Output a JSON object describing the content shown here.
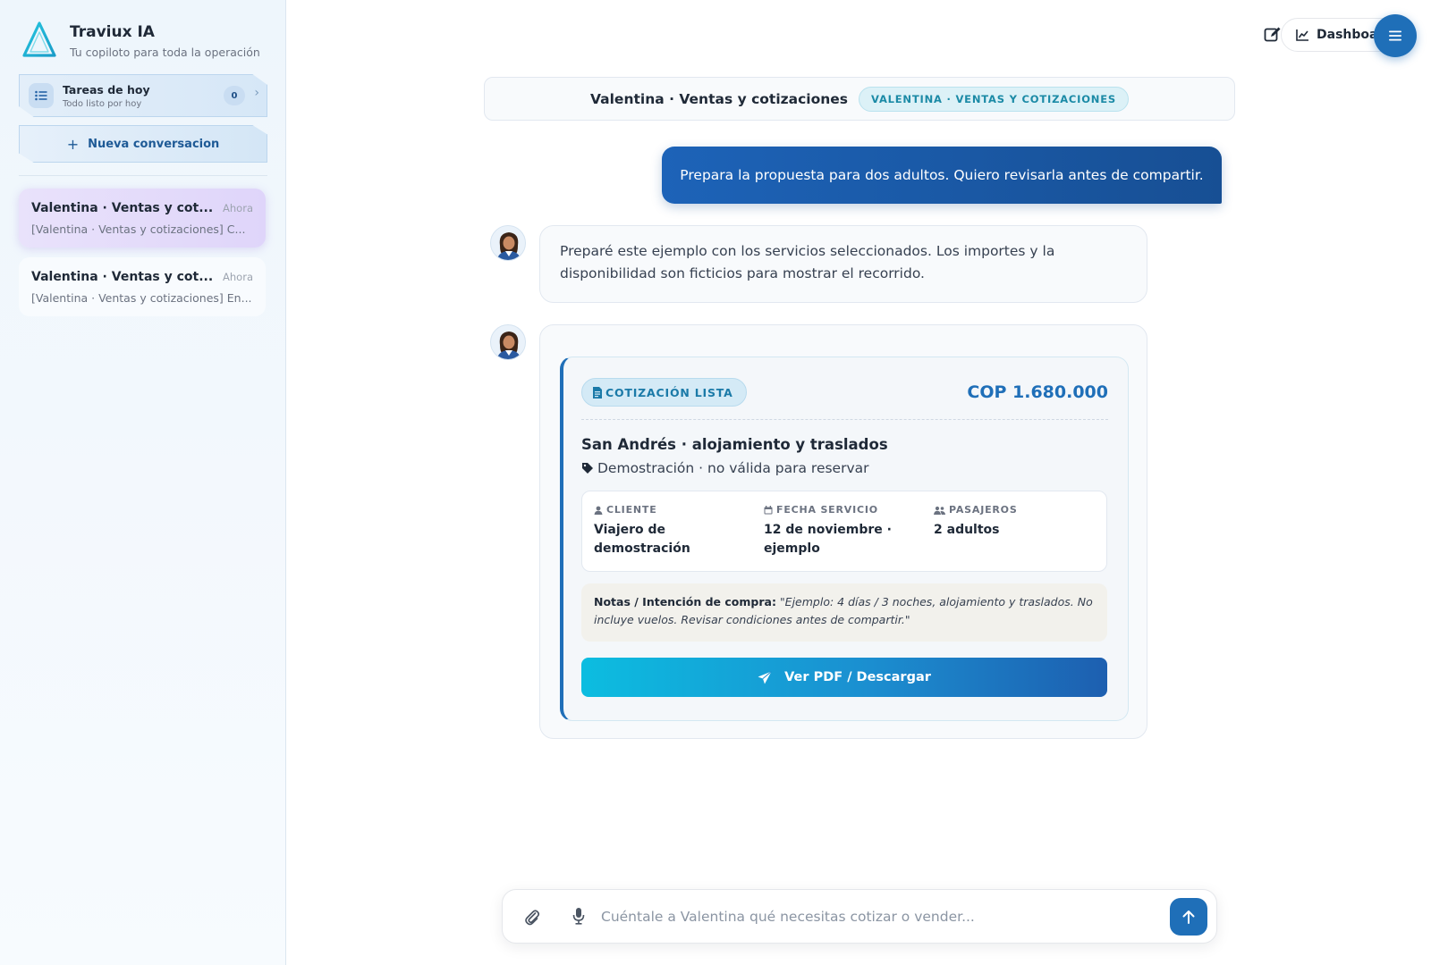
{
  "app": {
    "title": "Traviux IA",
    "subtitle": "Tu copiloto para toda la operación"
  },
  "sidebar": {
    "tasks": {
      "title": "Tareas de hoy",
      "subtitle": "Todo listo por hoy",
      "count": "0"
    },
    "new_conversation_label": "Nueva conversacion",
    "conversations": [
      {
        "title": "Valentina · Ventas y cot...",
        "time": "Ahora",
        "preview": "[Valentina · Ventas y cotizaciones] C...",
        "active": true
      },
      {
        "title": "Valentina · Ventas y cot...",
        "time": "Ahora",
        "preview": "[Valentina · Ventas y cotizaciones] En...",
        "active": false
      }
    ]
  },
  "topbar": {
    "dashboard_label": "Dashboa"
  },
  "chat": {
    "title": "Valentina · Ventas y cotizaciones",
    "badge": "VALENTINA · VENTAS Y COTIZACIONES",
    "user_message": "Prepara la propuesta para dos adultos. Quiero revisarla antes de compartir.",
    "bot_message": "Preparé este ejemplo con los servicios seleccionados. Los importes y la disponibilidad son ficticios para mostrar el recorrido."
  },
  "quote": {
    "badge": "COTIZACIÓN LISTA",
    "total": "COP 1.680.000",
    "title": "San Andrés · alojamiento y traslados",
    "subtitle": "Demostración · no válida para reservar",
    "client_label": "CLIENTE",
    "client_value": "Viajero de demostración",
    "date_label": "FECHA SERVICIO",
    "date_value": "12 de noviembre · ejemplo",
    "passengers_label": "PASAJEROS",
    "passengers_value": "2 adultos",
    "notes_label": "Notas / Intención de compra:",
    "notes_text": "\"Ejemplo: 4 días / 3 noches, alojamiento y traslados. No incluye vuelos. Revisar condiciones antes de compartir.\"",
    "pdf_button": "Ver PDF / Descargar"
  },
  "composer": {
    "placeholder": "Cuéntale a Valentina qué necesitas cotizar o vender..."
  },
  "colors": {
    "primary": "#1f6fb8",
    "accent_teal": "#1b8aa6",
    "active_conv": "#e4dcfa"
  }
}
